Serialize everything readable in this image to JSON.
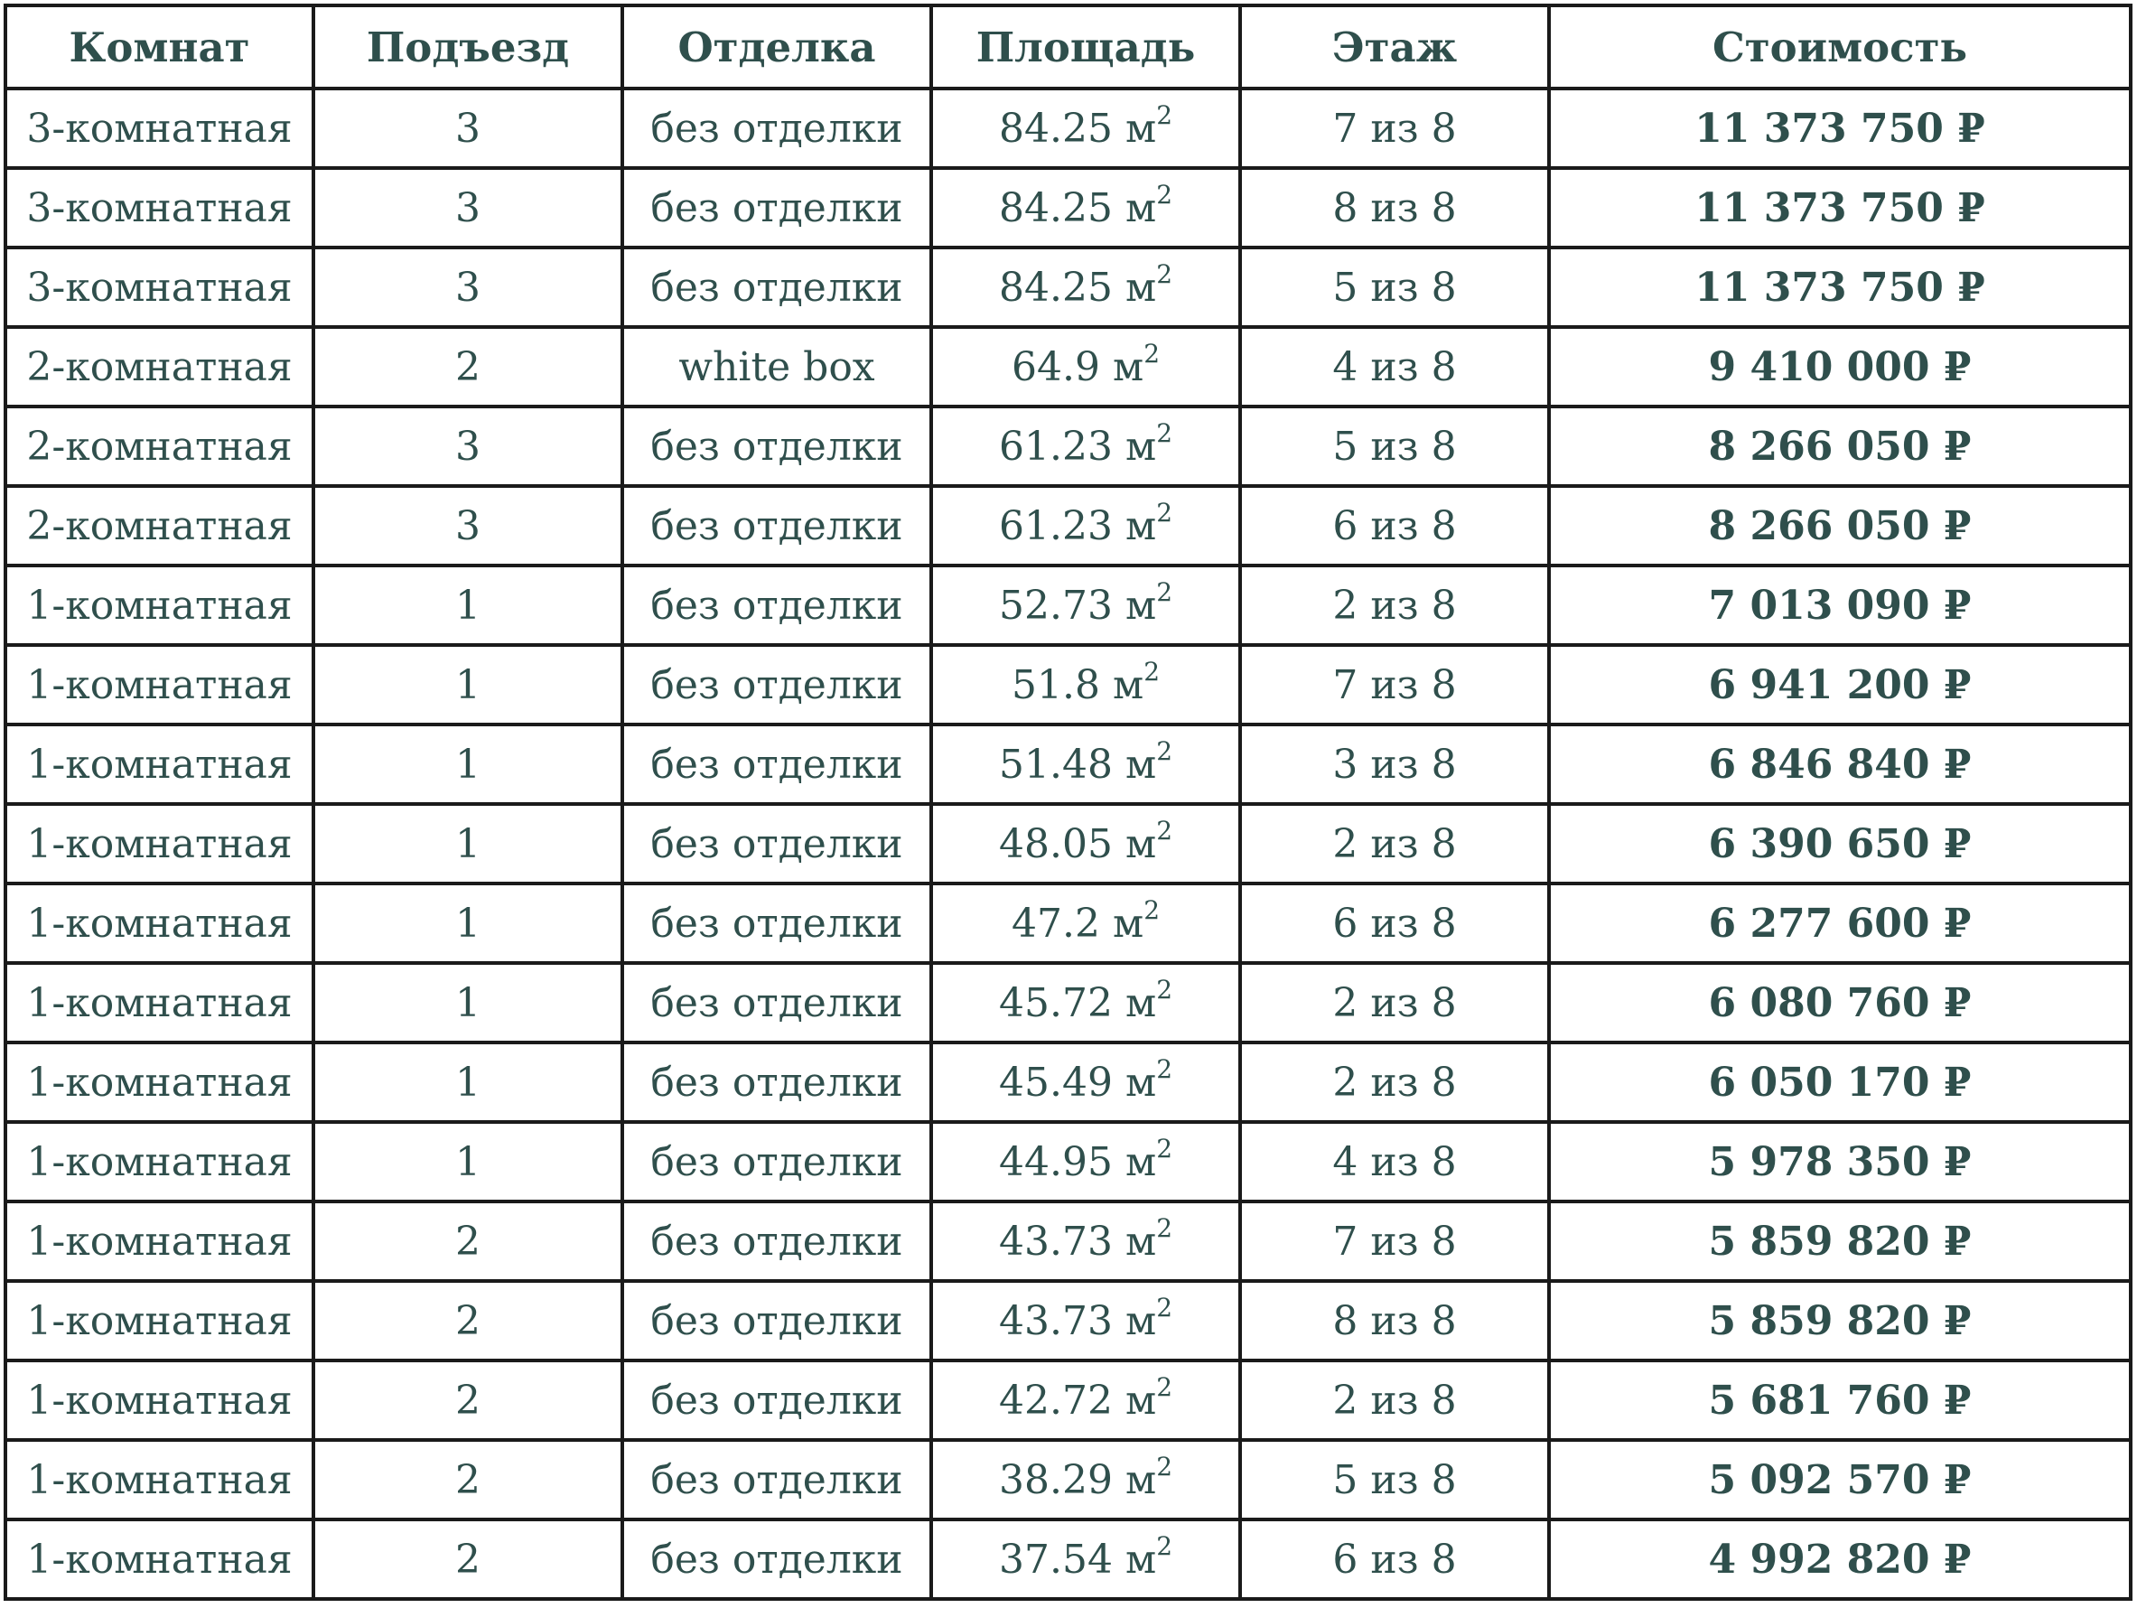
{
  "table": {
    "headers": [
      "Комнат",
      "Подъезд",
      "Отделка",
      "Площадь",
      "Этаж",
      "Стоимость"
    ],
    "area_unit": "м",
    "area_unit_power": "2",
    "rows": [
      {
        "rooms": "3-комнатная",
        "entrance": "3",
        "finish": "без отделки",
        "area": "84.25",
        "floor": "7 из 8",
        "price": "11 373 750 ₽"
      },
      {
        "rooms": "3-комнатная",
        "entrance": "3",
        "finish": "без отделки",
        "area": "84.25",
        "floor": "8 из 8",
        "price": "11 373 750 ₽"
      },
      {
        "rooms": "3-комнатная",
        "entrance": "3",
        "finish": "без отделки",
        "area": "84.25",
        "floor": "5 из 8",
        "price": "11 373 750 ₽"
      },
      {
        "rooms": "2-комнатная",
        "entrance": "2",
        "finish": "white box",
        "area": "64.9",
        "floor": "4 из 8",
        "price": "9 410 000 ₽"
      },
      {
        "rooms": "2-комнатная",
        "entrance": "3",
        "finish": "без отделки",
        "area": "61.23",
        "floor": "5 из 8",
        "price": "8 266 050 ₽"
      },
      {
        "rooms": "2-комнатная",
        "entrance": "3",
        "finish": "без отделки",
        "area": "61.23",
        "floor": "6 из 8",
        "price": "8 266 050 ₽"
      },
      {
        "rooms": "1-комнатная",
        "entrance": "1",
        "finish": "без отделки",
        "area": "52.73",
        "floor": "2 из 8",
        "price": "7 013 090 ₽"
      },
      {
        "rooms": "1-комнатная",
        "entrance": "1",
        "finish": "без отделки",
        "area": "51.8",
        "floor": "7 из 8",
        "price": "6 941 200 ₽"
      },
      {
        "rooms": "1-комнатная",
        "entrance": "1",
        "finish": "без отделки",
        "area": "51.48",
        "floor": "3 из 8",
        "price": "6 846 840 ₽"
      },
      {
        "rooms": "1-комнатная",
        "entrance": "1",
        "finish": "без отделки",
        "area": "48.05",
        "floor": "2 из 8",
        "price": "6 390 650 ₽"
      },
      {
        "rooms": "1-комнатная",
        "entrance": "1",
        "finish": "без отделки",
        "area": "47.2",
        "floor": "6 из 8",
        "price": "6 277 600 ₽"
      },
      {
        "rooms": "1-комнатная",
        "entrance": "1",
        "finish": "без отделки",
        "area": "45.72",
        "floor": "2 из 8",
        "price": "6 080 760 ₽"
      },
      {
        "rooms": "1-комнатная",
        "entrance": "1",
        "finish": "без отделки",
        "area": "45.49",
        "floor": "2 из 8",
        "price": "6 050 170 ₽"
      },
      {
        "rooms": "1-комнатная",
        "entrance": "1",
        "finish": "без отделки",
        "area": "44.95",
        "floor": "4 из 8",
        "price": "5 978 350 ₽"
      },
      {
        "rooms": "1-комнатная",
        "entrance": "2",
        "finish": "без отделки",
        "area": "43.73",
        "floor": "7 из 8",
        "price": "5 859 820 ₽"
      },
      {
        "rooms": "1-комнатная",
        "entrance": "2",
        "finish": "без отделки",
        "area": "43.73",
        "floor": "8 из 8",
        "price": "5 859 820 ₽"
      },
      {
        "rooms": "1-комнатная",
        "entrance": "2",
        "finish": "без отделки",
        "area": "42.72",
        "floor": "2 из 8",
        "price": "5 681 760 ₽"
      },
      {
        "rooms": "1-комнатная",
        "entrance": "2",
        "finish": "без отделки",
        "area": "38.29",
        "floor": "5 из 8",
        "price": "5 092 570 ₽"
      },
      {
        "rooms": "1-комнатная",
        "entrance": "2",
        "finish": "без отделки",
        "area": "37.54",
        "floor": "6 из 8",
        "price": "4 992 820 ₽"
      }
    ]
  },
  "colors": {
    "text": "#2f4f4c",
    "border": "#1a1a1a",
    "background": "#ffffff"
  }
}
